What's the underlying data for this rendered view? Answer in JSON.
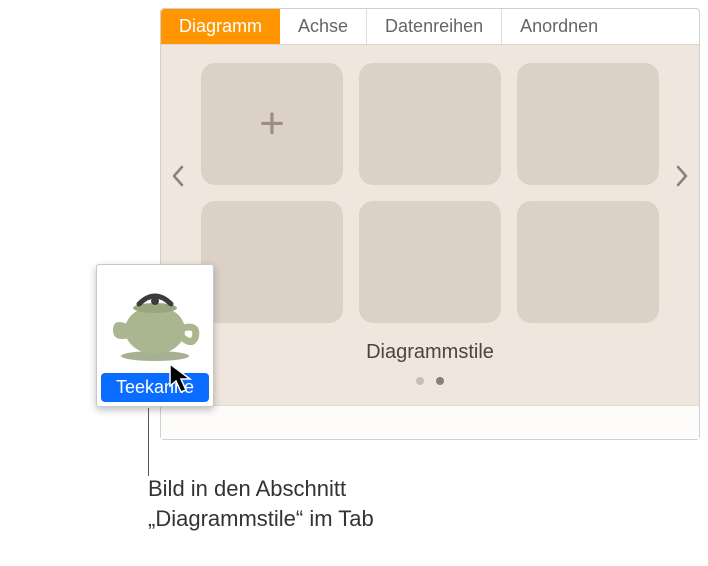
{
  "tabs": {
    "diagramm": "Diagramm",
    "achse": "Achse",
    "datenreihen": "Datenreihen",
    "anordnen": "Anordnen"
  },
  "active_tab": "diagramm",
  "styles": {
    "label": "Diagrammstile"
  },
  "drag": {
    "label": "Teekanne"
  },
  "callout": "Bild in den Abschnitt „Diagrammstile“ im Tab"
}
